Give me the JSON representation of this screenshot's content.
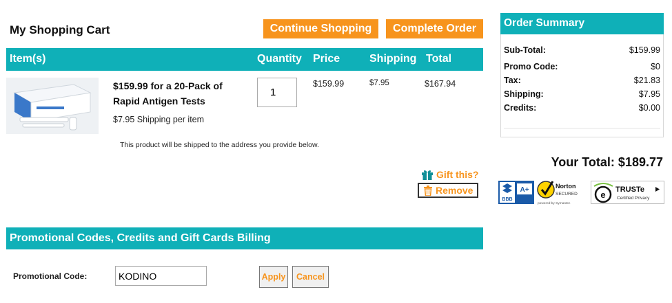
{
  "cart": {
    "title": "My Shopping Cart",
    "continue_label": "Continue Shopping",
    "complete_label": "Complete Order"
  },
  "table": {
    "headers": {
      "items": "Item(s)",
      "quantity": "Quantity",
      "price": "Price",
      "shipping": "Shipping",
      "total": "Total"
    }
  },
  "item": {
    "name": "$159.99 for a 20-Pack of Rapid Antigen Tests",
    "shipping_note": "$7.95 Shipping per item",
    "quantity": "1",
    "price": "$159.99",
    "shipping": "$7.95",
    "total": "$167.94",
    "ship_address_note": "This product will be shipped to the address you provide below.",
    "gift_label": "Gift this?",
    "remove_label": "Remove"
  },
  "promo": {
    "section_title": "Promotional Codes, Credits and Gift Cards Billing",
    "code_label": "Promotional Code:",
    "code_value": "KODINO",
    "apply_label": "Apply",
    "cancel_label": "Cancel"
  },
  "summary": {
    "title": "Order Summary",
    "rows": [
      {
        "label": "Sub-Total:",
        "value": "$159.99"
      },
      {
        "label": "Promo Code:",
        "value": "$0"
      },
      {
        "label": "Tax:",
        "value": "$21.83"
      },
      {
        "label": "Shipping:",
        "value": "$7.95"
      },
      {
        "label": "Credits:",
        "value": "$0.00"
      }
    ],
    "total_text": "Your Total: $189.77"
  },
  "badges": {
    "bbb_grade": "A+",
    "bbb_text": "BBB",
    "norton_name": "Norton",
    "norton_sub": "SECURED",
    "norton_powered": "powered by Symantec",
    "truste_name": "TRUSTe",
    "truste_sub": "Certified Privacy"
  },
  "colors": {
    "teal": "#0fb0b8",
    "orange": "#f7941d"
  },
  "icons": [
    "gift-icon",
    "trash-icon",
    "checkmark-icon"
  ]
}
